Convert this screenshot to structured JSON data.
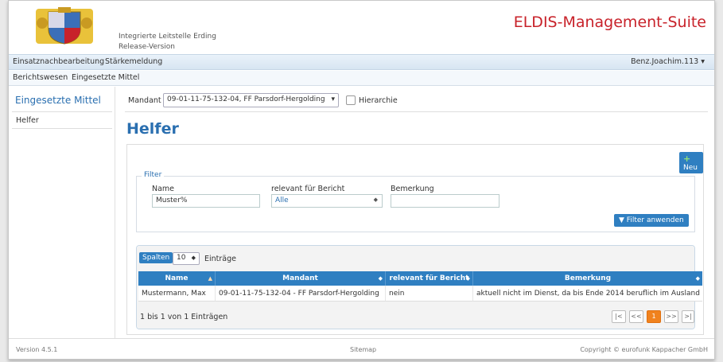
{
  "header": {
    "org_line1": "Integrierte Leitstelle Erding",
    "org_line2": "Release-Version",
    "brand": "ELDIS-Management-Suite"
  },
  "nav": {
    "primary": [
      "Einsatznachbearbeitung",
      "Stärkemeldung"
    ],
    "user": "Benz.Joachim.113",
    "secondary": [
      "Berichtswesen",
      "Eingesetzte Mittel"
    ]
  },
  "sidebar": {
    "title": "Eingesetzte Mittel",
    "items": [
      "Helfer"
    ]
  },
  "main": {
    "mandant_label": "Mandant",
    "mandant_value": "09-01-11-75-132-04, FF Parsdorf-Hergolding",
    "hierarchie_label": "Hierarchie",
    "page_title": "Helfer",
    "new_button": "Neu",
    "filter": {
      "legend": "Filter",
      "name_label": "Name",
      "name_value": "Muster%",
      "relevant_label": "relevant für Bericht",
      "relevant_value": "Alle",
      "bemerkung_label": "Bemerkung",
      "bemerkung_value": "",
      "apply_button": "Filter anwenden"
    },
    "table": {
      "columns_button": "Spalten",
      "page_size": "10",
      "entries_label": "Einträge",
      "headers": [
        "Name",
        "Mandant",
        "relevant für Bericht",
        "Bemerkung"
      ],
      "rows": [
        [
          "Mustermann, Max",
          "09-01-11-75-132-04 - FF Parsdorf-Hergolding",
          "nein",
          "aktuell nicht im Dienst, da bis Ende 2014 beruflich im Ausland"
        ]
      ],
      "info": "1 bis 1 von 1 Einträgen",
      "pager": [
        "|<",
        "<<",
        "1",
        ">>",
        ">|"
      ]
    }
  },
  "footer": {
    "version": "Version 4.5.1",
    "sitemap": "Sitemap",
    "copyright": "Copyright © eurofunk Kappacher GmbH"
  }
}
